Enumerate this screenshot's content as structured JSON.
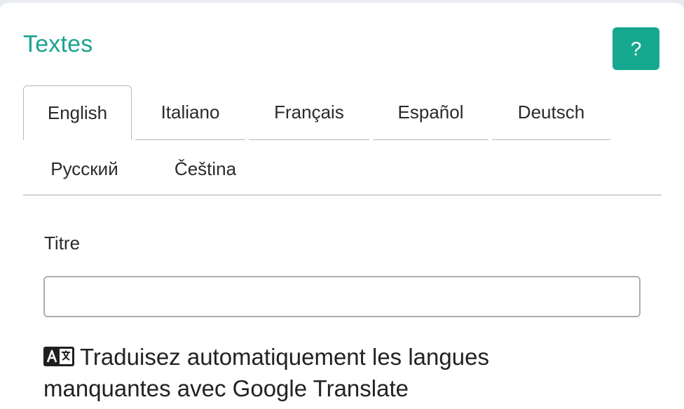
{
  "panel": {
    "title": "Textes",
    "help_label": "?"
  },
  "tabs": [
    {
      "label": "English",
      "active": true
    },
    {
      "label": "Italiano",
      "active": false
    },
    {
      "label": "Français",
      "active": false
    },
    {
      "label": "Español",
      "active": false
    },
    {
      "label": "Deutsch",
      "active": false
    },
    {
      "label": "Русский",
      "active": false
    },
    {
      "label": "Čeština",
      "active": false
    }
  ],
  "form": {
    "title_label": "Titre",
    "title_value": "",
    "title_placeholder": ""
  },
  "translate": {
    "icon": "translate-icon",
    "label": "Traduisez automatiquement les langues manquantes avec Google Translate"
  },
  "colors": {
    "accent": "#16a88e",
    "title": "#1aa391"
  }
}
